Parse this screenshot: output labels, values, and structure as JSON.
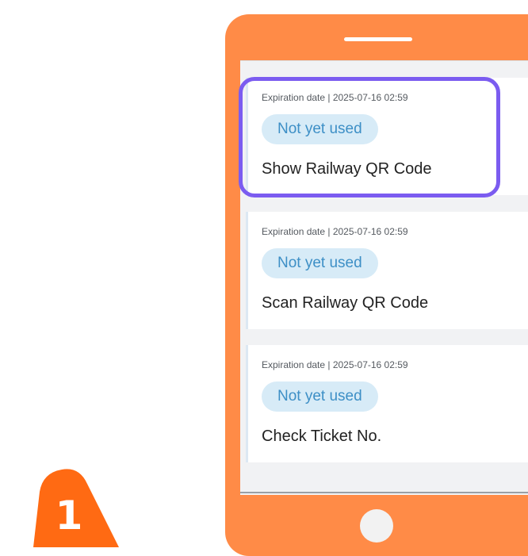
{
  "step": {
    "number": "1",
    "color": "#ff6a13"
  },
  "phone": {
    "frame_color": "#ff8b47"
  },
  "highlight_color": "#7b5cf0",
  "tickets": [
    {
      "expiry": "Expiration date | 2025-07-16 02:59",
      "status": "Not yet used",
      "action": "Show Railway QR Code",
      "highlighted": true
    },
    {
      "expiry": "Expiration date | 2025-07-16 02:59",
      "status": "Not yet used",
      "action": "Scan Railway QR Code",
      "highlighted": false
    },
    {
      "expiry": "Expiration date | 2025-07-16 02:59",
      "status": "Not yet used",
      "action": "Check Ticket No.",
      "highlighted": false
    }
  ]
}
